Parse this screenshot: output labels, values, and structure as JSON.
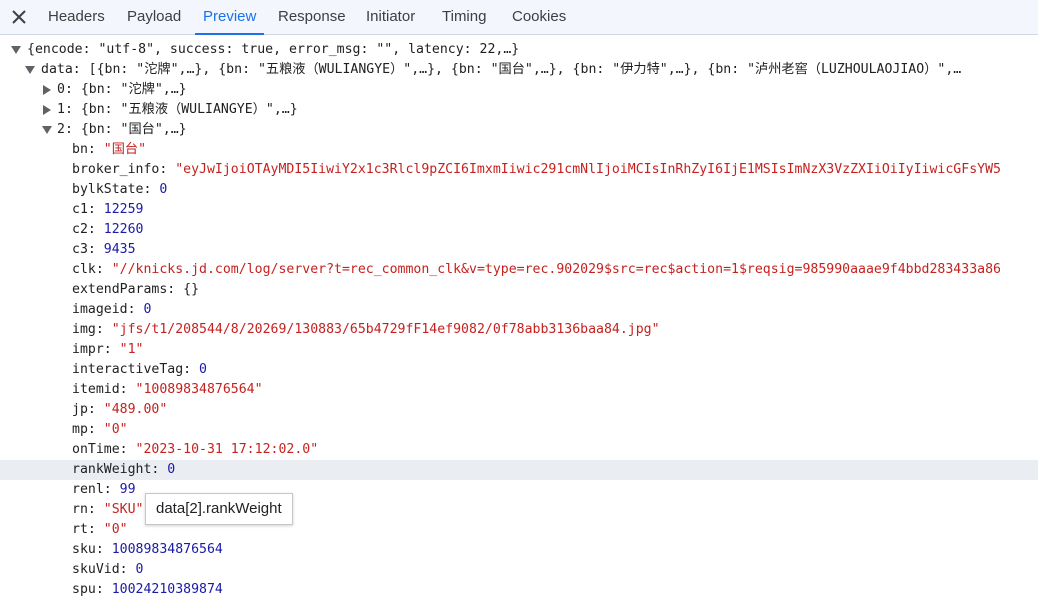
{
  "tabs": [
    {
      "label": "Headers"
    },
    {
      "label": "Payload"
    },
    {
      "label": "Preview"
    },
    {
      "label": "Response"
    },
    {
      "label": "Initiator"
    },
    {
      "label": "Timing"
    },
    {
      "label": "Cookies"
    }
  ],
  "active_tab": "Preview",
  "tree": {
    "root_summary": "{encode: \"utf-8\", success: true, error_msg: \"\", latency: 22,…}",
    "data_key": "data",
    "data_summary": "[{bn: \"沱牌\",…}, {bn: \"五粮液（WULIANGYE）\",…}, {bn: \"国台\",…}, {bn: \"伊力特\",…}, {bn: \"泸州老窖（LUZHOULAOJIAO）\",…",
    "item0_key": "0",
    "item0_summary": "{bn: \"沱牌\",…}",
    "item1_key": "1",
    "item1_summary": "{bn: \"五粮液（WULIANGYE）\",…}",
    "item2_key": "2",
    "item2_summary": "{bn: \"国台\",…}",
    "fields": [
      {
        "key": "bn",
        "value": "\"国台\"",
        "type": "str"
      },
      {
        "key": "broker_info",
        "value": "\"eyJwIjoiOTAyMDI5IiwiY2x1c3Rlcl9pZCI6ImxmIiwic291cmNlIjoiMCIsInRhZyI6IjE1MSIsImNzX3VzZXIiOiIyIiwicGFsYW5",
        "type": "str"
      },
      {
        "key": "bylkState",
        "value": "0",
        "type": "num"
      },
      {
        "key": "c1",
        "value": "12259",
        "type": "num"
      },
      {
        "key": "c2",
        "value": "12260",
        "type": "num"
      },
      {
        "key": "c3",
        "value": "9435",
        "type": "num"
      },
      {
        "key": "clk",
        "value": "\"//knicks.jd.com/log/server?t=rec_common_clk&v=type=rec.902029$src=rec$action=1$reqsig=985990aaae9f4bbd283433a86",
        "type": "str"
      },
      {
        "key": "extendParams",
        "value": "{}",
        "type": "txt"
      },
      {
        "key": "imageid",
        "value": "0",
        "type": "num"
      },
      {
        "key": "img",
        "value": "\"jfs/t1/208544/8/20269/130883/65b4729fF14ef9082/0f78abb3136baa84.jpg\"",
        "type": "str"
      },
      {
        "key": "impr",
        "value": "\"1\"",
        "type": "str"
      },
      {
        "key": "interactiveTag",
        "value": "0",
        "type": "num"
      },
      {
        "key": "itemid",
        "value": "\"10089834876564\"",
        "type": "str"
      },
      {
        "key": "jp",
        "value": "\"489.00\"",
        "type": "str"
      },
      {
        "key": "mp",
        "value": "\"0\"",
        "type": "str"
      },
      {
        "key": "onTime",
        "value": "\"2023-10-31 17:12:02.0\"",
        "type": "str"
      },
      {
        "key": "rankWeight",
        "value": "0",
        "type": "num"
      },
      {
        "key": "renl",
        "value": "99",
        "type": "num"
      },
      {
        "key": "rn",
        "value": "\"SKU\"",
        "type": "str"
      },
      {
        "key": "rt",
        "value": "\"0\"",
        "type": "str"
      },
      {
        "key": "sku",
        "value": "10089834876564",
        "type": "num"
      },
      {
        "key": "skuVid",
        "value": "0",
        "type": "num"
      },
      {
        "key": "spu",
        "value": "10024210389874",
        "type": "num"
      }
    ],
    "highlighted_key": "rankWeight"
  },
  "tooltip": "data[2].rankWeight"
}
